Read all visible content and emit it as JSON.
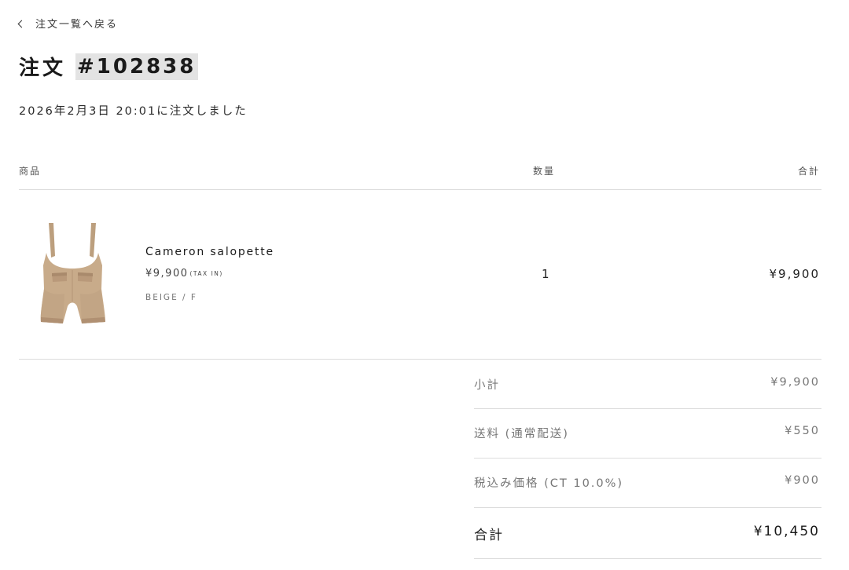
{
  "nav": {
    "back_label": "注文一覧へ戻る"
  },
  "order": {
    "title_prefix": "注文",
    "number": "#102838",
    "placed_at": "2026年2月3日 20:01に注文しました"
  },
  "table": {
    "headers": {
      "product": "商品",
      "quantity": "数量",
      "total": "合計"
    },
    "items": [
      {
        "name": "Cameron salopette",
        "price": "¥9,900",
        "tax_note": "(TAX IN)",
        "variant": "BEIGE / F",
        "quantity": "1",
        "line_total": "¥9,900",
        "image_icon": "salopette-product-image"
      }
    ]
  },
  "summary": {
    "subtotal_label": "小計",
    "subtotal_value": "¥9,900",
    "shipping_label": "送料 (通常配送)",
    "shipping_value": "¥550",
    "tax_label": "税込み価格 (CT 10.0%)",
    "tax_value": "¥900",
    "total_label": "合計",
    "total_value": "¥10,450"
  },
  "colors": {
    "text": "#1f1f1f",
    "muted": "#777777",
    "divider": "#dcdcdc",
    "highlight": "#e3e3e3",
    "product_beige": "#c8ab8a"
  }
}
